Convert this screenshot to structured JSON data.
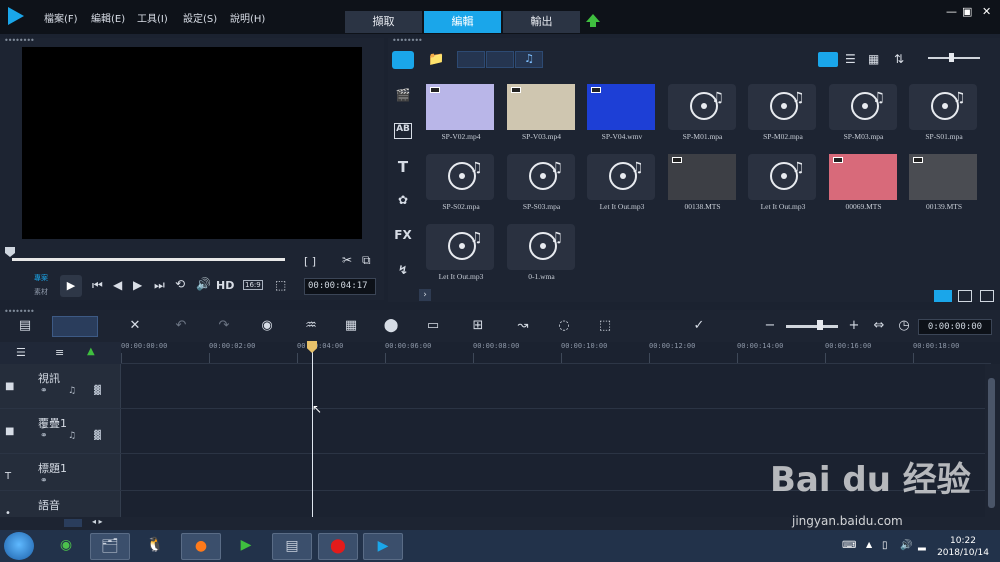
{
  "menu": {
    "items": [
      "檔案(F)",
      "編輯(E)",
      "工具(I)",
      "設定(S)",
      "說明(H)"
    ]
  },
  "tabs": {
    "capture": "擷取",
    "edit": "編輯",
    "share": "輸出"
  },
  "window_controls": [
    "—",
    "▣",
    "✕"
  ],
  "player": {
    "project_label": "專案",
    "clip_label": "素材",
    "hd": "HD",
    "aspect": "16:9",
    "timecode": "00:00:04:17",
    "marks": "[  ]"
  },
  "library": {
    "items": [
      {
        "name": "SP-V02.mp4",
        "kind": "video",
        "color": "#b9b6e8"
      },
      {
        "name": "SP-V03.mp4",
        "kind": "video",
        "color": "#cfc6b0"
      },
      {
        "name": "SP-V04.wmv",
        "kind": "video",
        "color": "#1d3fd6"
      },
      {
        "name": "SP-M01.mpa",
        "kind": "audio"
      },
      {
        "name": "SP-M02.mpa",
        "kind": "audio"
      },
      {
        "name": "SP-M03.mpa",
        "kind": "audio"
      },
      {
        "name": "SP-S01.mpa",
        "kind": "audio"
      },
      {
        "name": "SP-S02.mpa",
        "kind": "audio"
      },
      {
        "name": "SP-S03.mpa",
        "kind": "audio"
      },
      {
        "name": "Let It Out.mp3",
        "kind": "audio"
      },
      {
        "name": "00138.MTS",
        "kind": "video",
        "color": "#3d3f45"
      },
      {
        "name": "Let It Out.mp3",
        "kind": "audio"
      },
      {
        "name": "00069.MTS",
        "kind": "video",
        "color": "#d86a7a"
      },
      {
        "name": "00139.MTS",
        "kind": "video",
        "color": "#4a4c52"
      },
      {
        "name": "Let It Out.mp3",
        "kind": "audio"
      },
      {
        "name": "0-1.wma",
        "kind": "audio"
      }
    ]
  },
  "timeline": {
    "timecode": "0:00:00:00",
    "ruler": [
      "00:00:00:00",
      "00:00:02:00",
      "00:00:04:00",
      "00:00:06:00",
      "00:00:08:00",
      "00:00:10:00",
      "00:00:12:00",
      "00:00:14:00",
      "00:00:16:00",
      "00:00:18:00"
    ],
    "tracks": [
      {
        "name": "視訊",
        "icon": "video-track-icon"
      },
      {
        "name": "覆疊1",
        "icon": "overlay-track-icon"
      },
      {
        "name": "標題1",
        "icon": "title-track-icon"
      },
      {
        "name": "語音",
        "icon": "voice-track-icon"
      }
    ]
  },
  "taskbar": {
    "time": "10:22",
    "date": "2018/10/14"
  },
  "watermark": {
    "brand": "Bai du 经验",
    "url": "jingyan.baidu.com"
  }
}
